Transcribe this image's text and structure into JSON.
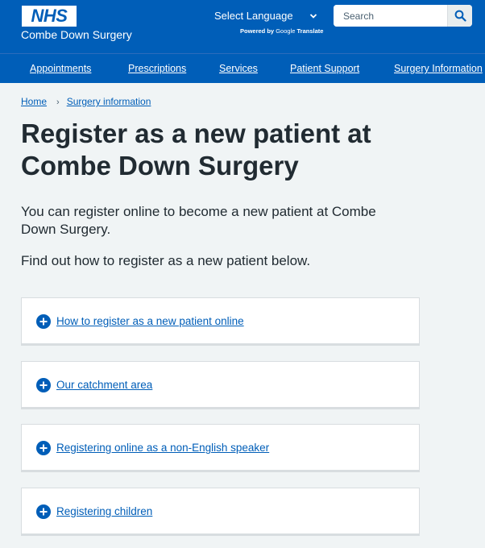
{
  "header": {
    "logo": "NHS",
    "practice_name": "Combe Down Surgery",
    "language_select_label": "Select Language",
    "powered_by": "Powered by",
    "google": "Google",
    "translate": "Translate",
    "search_placeholder": "Search"
  },
  "nav": {
    "items": [
      {
        "label": "Appointments"
      },
      {
        "label": "Prescriptions"
      },
      {
        "label": "Services"
      },
      {
        "label": "Patient Support"
      },
      {
        "label": "Surgery Information"
      }
    ]
  },
  "breadcrumb": {
    "home": "Home",
    "current": "Surgery information"
  },
  "main": {
    "title": "Register as a new patient at Combe Down Surgery",
    "lede": "You can register online to become a new patient at Combe Down Surgery.",
    "sub": "Find out how to register as a new patient below.",
    "details": [
      {
        "label": "How to register as a new patient online"
      },
      {
        "label": "Our catchment area"
      },
      {
        "label": "Registering online as a non-English speaker"
      },
      {
        "label": "Registering children"
      }
    ]
  },
  "colors": {
    "nhs_blue": "#005eb8",
    "page_bg": "#f0f4f5",
    "text": "#212b32"
  },
  "icons": {
    "search": "search-icon",
    "chevron": "chevron-down-icon",
    "expand": "plus-circle-icon"
  }
}
